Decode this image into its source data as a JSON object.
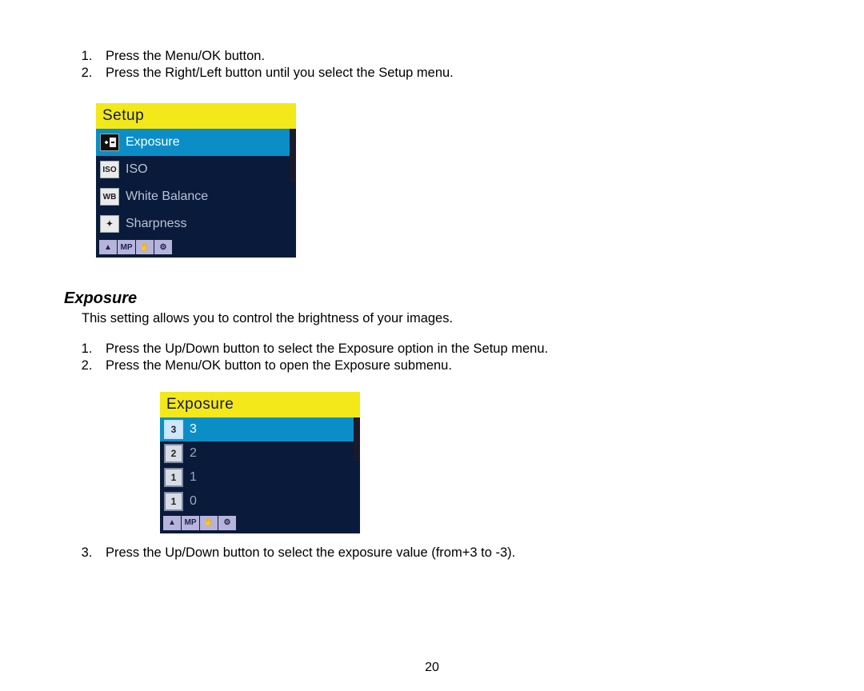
{
  "steps_top": [
    "Press the Menu/OK button.",
    "Press the Right/Left button until you select the Setup menu."
  ],
  "screen1": {
    "title": "Setup",
    "items": [
      {
        "icon": "exposure-icon",
        "glyph": "✦",
        "label": "Exposure",
        "selected": true
      },
      {
        "icon": "iso-icon",
        "glyph": "ISO",
        "label": "ISO",
        "selected": false
      },
      {
        "icon": "wb-icon",
        "glyph": "WB",
        "label": "White Balance",
        "selected": false
      },
      {
        "icon": "sharpness-icon",
        "glyph": "✦",
        "label": "Sharpness",
        "selected": false
      }
    ],
    "bottom": [
      "▲",
      "MP",
      "✋",
      "⚙"
    ]
  },
  "section_heading": "Exposure",
  "section_desc": "This setting allows you to control the brightness of your images.",
  "steps_mid": [
    "Press the Up/Down button to select the Exposure option in the Setup menu.",
    "Press the Menu/OK button to open the Exposure submenu."
  ],
  "screen2": {
    "title": "Exposure",
    "items": [
      {
        "value": "3",
        "label": "3",
        "selected": true
      },
      {
        "value": "2",
        "label": "2",
        "selected": false
      },
      {
        "value": "1",
        "label": "1",
        "selected": false
      },
      {
        "value": "1",
        "label": "0",
        "selected": false
      }
    ],
    "bottom": [
      "▲",
      "MP",
      "✋",
      "⚙"
    ]
  },
  "step_after": "Press the Up/Down button to select the exposure value (from+3 to -3).",
  "page_number": "20"
}
